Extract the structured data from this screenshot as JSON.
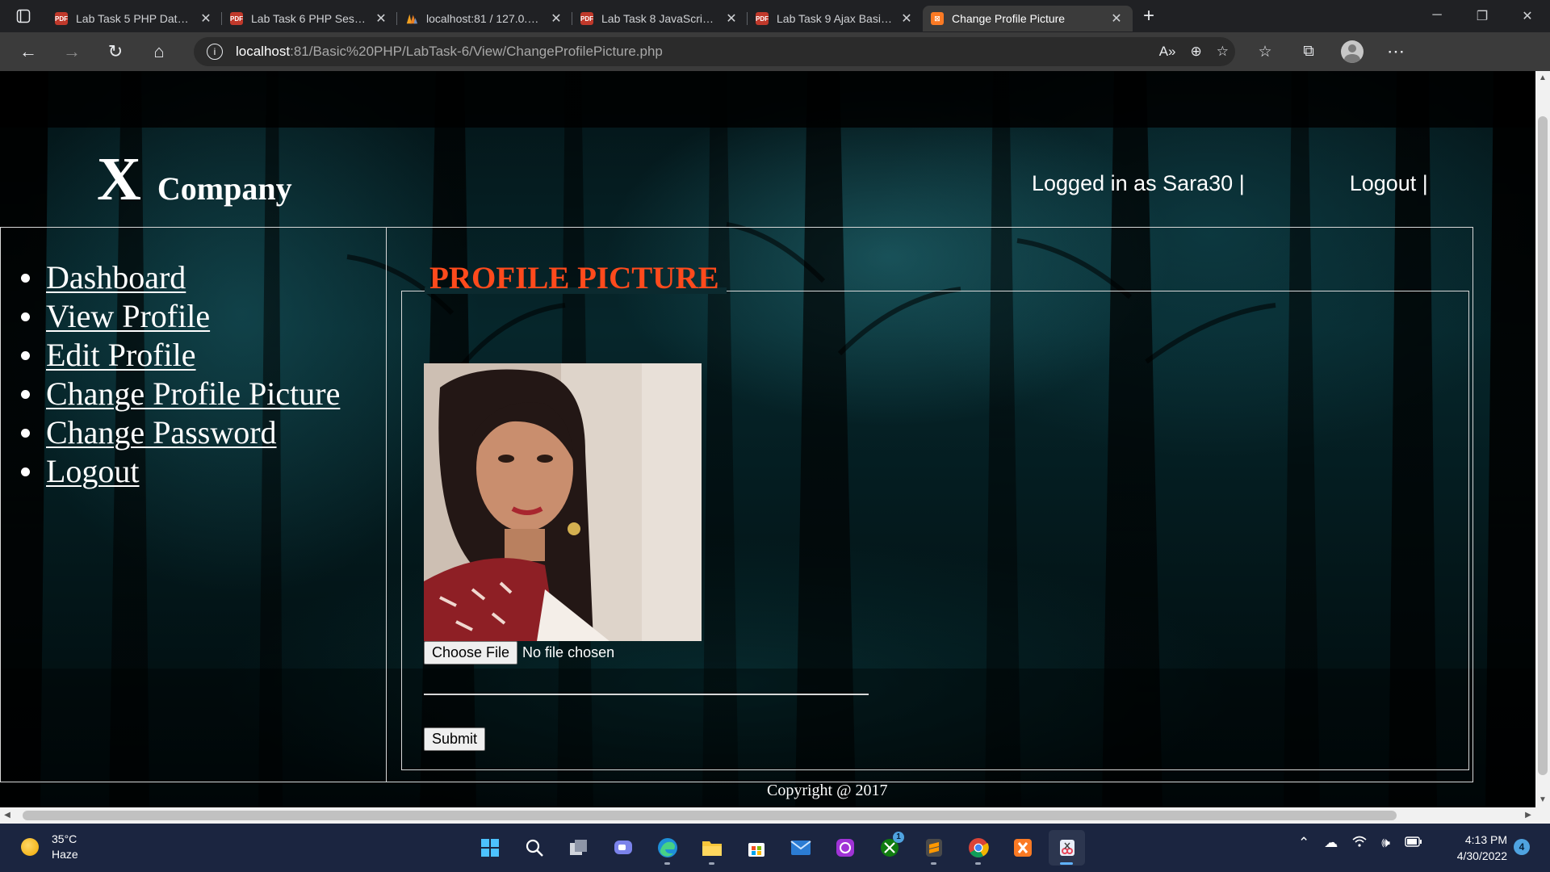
{
  "browser": {
    "tabs": [
      {
        "title": "Lab Task 5 PHP Database Co",
        "favicon": "pdf-icon",
        "color": "#c0392b"
      },
      {
        "title": "Lab Task 6 PHP Session Trac",
        "favicon": "pdf-icon",
        "color": "#c0392b"
      },
      {
        "title": "localhost:81 / 127.0.0.1 / lab",
        "favicon": "phpmyadmin-icon",
        "color": "#f0a020"
      },
      {
        "title": "Lab Task 8 JavaScript Basic S",
        "favicon": "pdf-icon",
        "color": "#c0392b"
      },
      {
        "title": "Lab Task 9 Ajax Basic FL 21-",
        "favicon": "pdf-icon",
        "color": "#c0392b"
      },
      {
        "title": "Change Profile Picture",
        "favicon": "xampp-icon",
        "color": "#fb7a24"
      }
    ],
    "active_tab": 5,
    "url_host": "localhost",
    "url_rest": ":81/Basic%20PHP/LabTask-6/View/ChangeProfilePicture.php"
  },
  "header": {
    "logo_mark": "X",
    "logo_name": "Company",
    "logged_in_text": "Logged in as Sara30 |",
    "logout_text": "Logout |"
  },
  "sidebar": {
    "items": [
      {
        "label": "Dashboard"
      },
      {
        "label": "View Profile"
      },
      {
        "label": "Edit Profile"
      },
      {
        "label": "Change Profile Picture"
      },
      {
        "label": "Change Password"
      },
      {
        "label": "Logout"
      }
    ]
  },
  "main": {
    "legend": "PROFILE PICTURE",
    "choose_file_label": "Choose File",
    "file_status": "No file chosen",
    "submit_label": "Submit",
    "legend_color": "#ff4a1c"
  },
  "footer": {
    "text": "Copyright @ 2017"
  },
  "taskbar": {
    "temperature": "35°C",
    "weather": "Haze",
    "time": "4:13 PM",
    "date": "4/30/2022",
    "notifications": "4",
    "xbox_badge": "1"
  }
}
